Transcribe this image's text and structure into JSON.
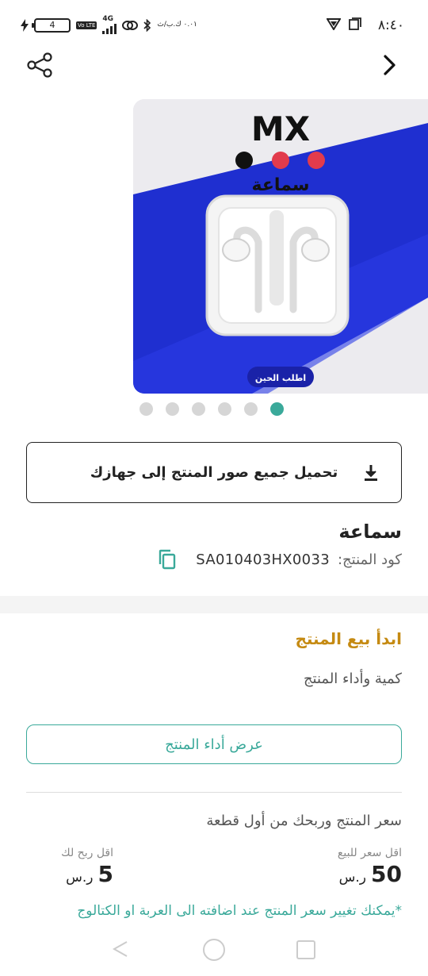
{
  "status_bar": {
    "time": "٨:٤٠",
    "battery": "4",
    "network": "4G",
    "volte": "Vo LTE",
    "speed": "٠.٠١ ك.ب/ث"
  },
  "nav": {
    "share_icon": "share-icon",
    "back_icon": "chevron-right-icon"
  },
  "hero": {
    "brand": "MX",
    "product_text": "سماعة",
    "cta": "اطلب الحين",
    "slide_count": 6,
    "active_slide": 6
  },
  "download": {
    "label": "تحميل جميع صور المنتج إلى جهازك",
    "icon": "download-icon"
  },
  "product": {
    "name": "سماعة",
    "code_label": "كود المنتج:",
    "code_value": "SA010403HX0033"
  },
  "sell": {
    "title": "ابدأ بيع المنتج",
    "subtitle": "كمية وأداء المنتج",
    "performance_button": "عرض أداء المنتج",
    "price_heading": "سعر المنتج وربحك من أول قطعة",
    "min_price_label": "اقل سعر للبيع",
    "min_price_value": "50",
    "min_price_currency": "ر.س",
    "min_profit_label": "اقل ربح لك",
    "min_profit_value": "5",
    "min_profit_currency": "ر.س",
    "note": "*يمكنك تغيير سعر المنتج عند اضافته الى العربة او الكتالوج"
  },
  "colors": {
    "accent": "#3aa99a",
    "title_gold": "#c58a12",
    "hero_blue": "#1f2fd0"
  }
}
